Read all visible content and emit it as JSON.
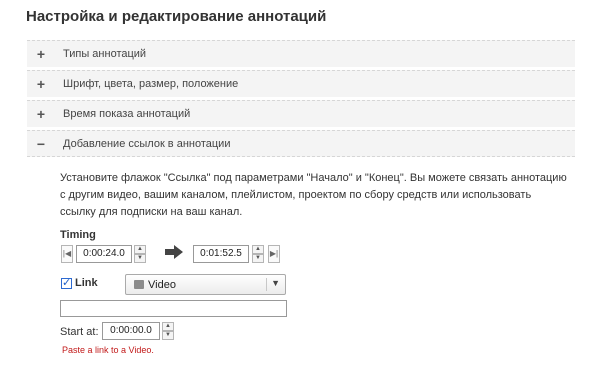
{
  "page_title": "Настройка и редактирование аннотаций",
  "sections": [
    {
      "toggle": "+",
      "label": "Типы аннотаций"
    },
    {
      "toggle": "+",
      "label": "Шрифт, цвета, размер, положение"
    },
    {
      "toggle": "+",
      "label": "Время показа аннотаций"
    },
    {
      "toggle": "−",
      "label": "Добавление ссылок в аннотации"
    }
  ],
  "description": "Установите флажок \"Ссылка\" под параметрами \"Начало\" и \"Конец\". Вы можете связать аннотацию с другим видео, вашим каналом, плейлистом, проектом по сбору средств или использовать ссылку для подписки на ваш канал.",
  "timing": {
    "title": "Timing",
    "start_value": "0:00:24.0",
    "end_value": "0:01:52.5",
    "step_back_glyph": "|◀",
    "step_forward_glyph": "▶|",
    "spin_up_glyph": "▲",
    "spin_down_glyph": "▼",
    "arrow_glyph": "➡"
  },
  "link": {
    "checkbox_glyph": "✓",
    "checked": true,
    "label": "Link",
    "type_value": "Video",
    "type_caret": "▼",
    "url_value": "",
    "start_label": "Start at:",
    "start_value": "0:00:00.0",
    "error": "Paste a link to a Video."
  },
  "icons": {
    "expand": "plus-icon",
    "collapse": "minus-icon",
    "arrow": "right-arrow-icon",
    "video": "video-icon"
  },
  "colors": {
    "section_background": "#f4f4f4",
    "error": "#c21a1a",
    "checkbox": "#1f5fc7"
  }
}
